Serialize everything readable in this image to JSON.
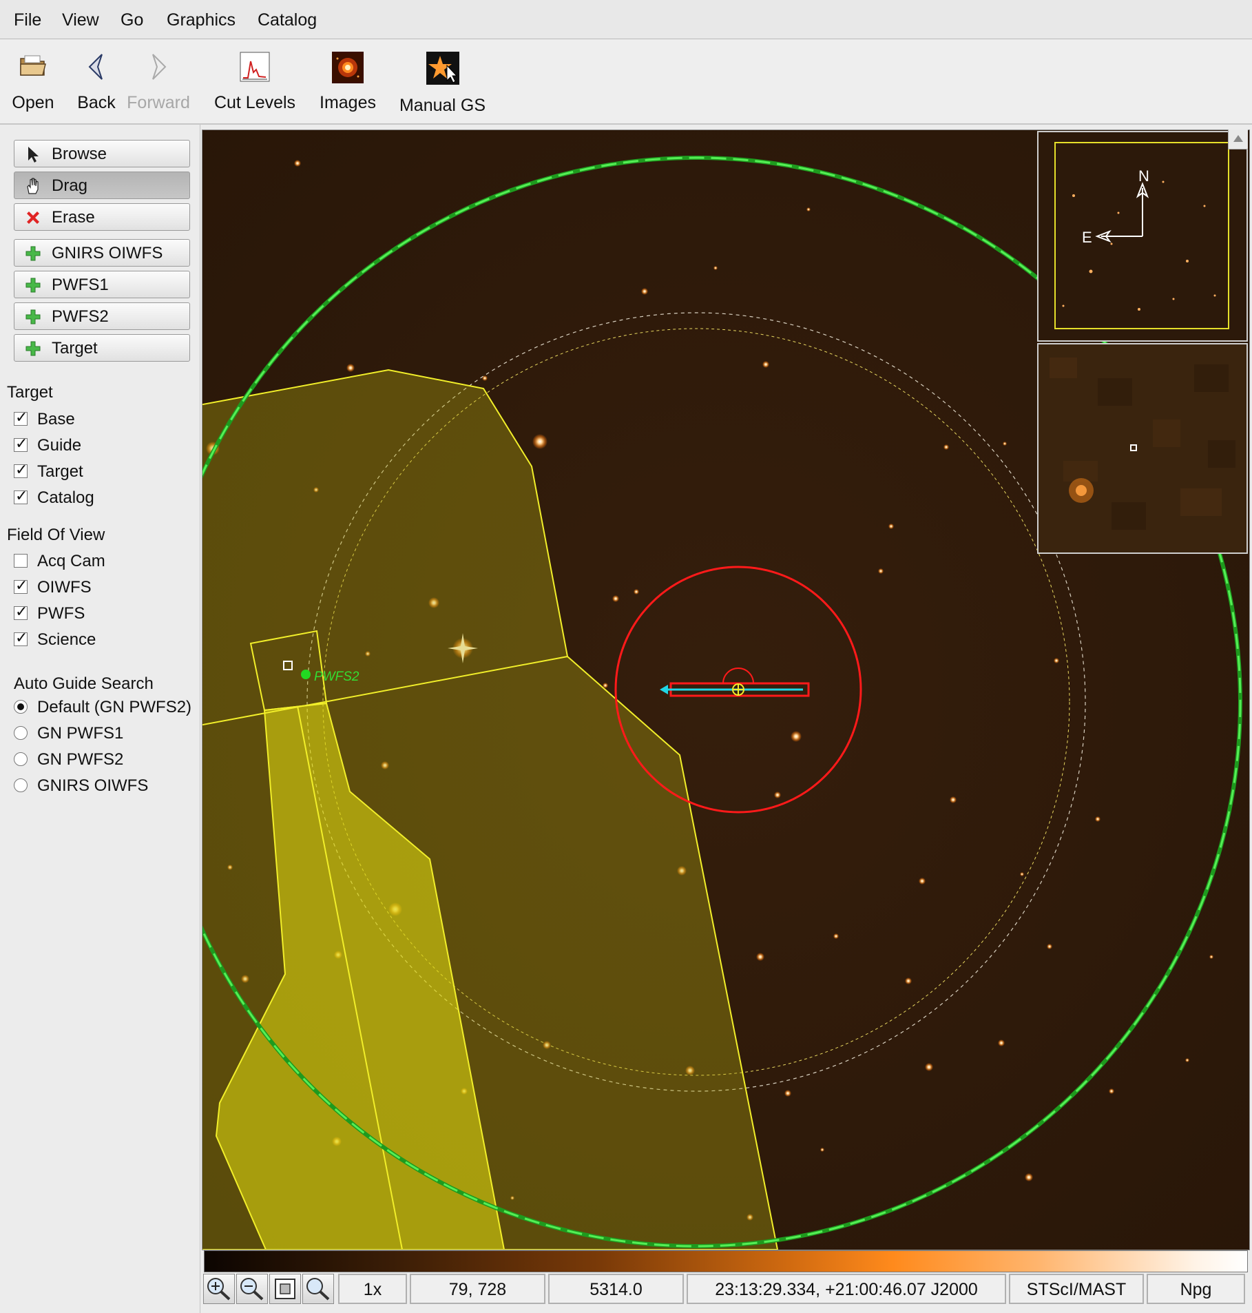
{
  "menu": [
    "File",
    "View",
    "Go",
    "Graphics",
    "Catalog"
  ],
  "toolbar": {
    "open": "Open",
    "back": "Back",
    "forward": "Forward",
    "cut_levels": "Cut Levels",
    "images": "Images",
    "manual_gs": "Manual GS"
  },
  "tools": {
    "browse": "Browse",
    "drag": "Drag",
    "erase": "Erase",
    "gnirs_oiwfs": "GNIRS OIWFS",
    "pwfs1": "PWFS1",
    "pwfs2": "PWFS2",
    "target": "Target"
  },
  "target_section": {
    "title": "Target",
    "items": [
      {
        "label": "Base",
        "checked": true
      },
      {
        "label": "Guide",
        "checked": true
      },
      {
        "label": "Target",
        "checked": true
      },
      {
        "label": "Catalog",
        "checked": true
      }
    ]
  },
  "fov_section": {
    "title": "Field Of View",
    "items": [
      {
        "label": "Acq Cam",
        "checked": false
      },
      {
        "label": "OIWFS",
        "checked": true
      },
      {
        "label": "PWFS",
        "checked": true
      },
      {
        "label": "Science",
        "checked": true
      }
    ]
  },
  "auto_guide": {
    "title": "Auto Guide Search",
    "options": [
      {
        "label": "Default (GN PWFS2)",
        "selected": true
      },
      {
        "label": "GN PWFS1",
        "selected": false
      },
      {
        "label": "GN PWFS2",
        "selected": false
      },
      {
        "label": "GNIRS OIWFS",
        "selected": false
      }
    ]
  },
  "image": {
    "guide_star_label": "PWFS2",
    "compass_n": "N",
    "compass_e": "E"
  },
  "status": {
    "zoom": "1x",
    "pixel": "79, 728",
    "value": "5314.0",
    "coords": "23:13:29.334, +21:00:46.07 J2000",
    "source": "STScI/MAST",
    "format": "Npg"
  },
  "colors": {
    "sky": "#2e1a0b",
    "patrol_field": "#22b322",
    "overlay_yellow": "#f2ef2a",
    "science_red": "#ff1a1a",
    "slit_cyan": "#20d6e6"
  }
}
